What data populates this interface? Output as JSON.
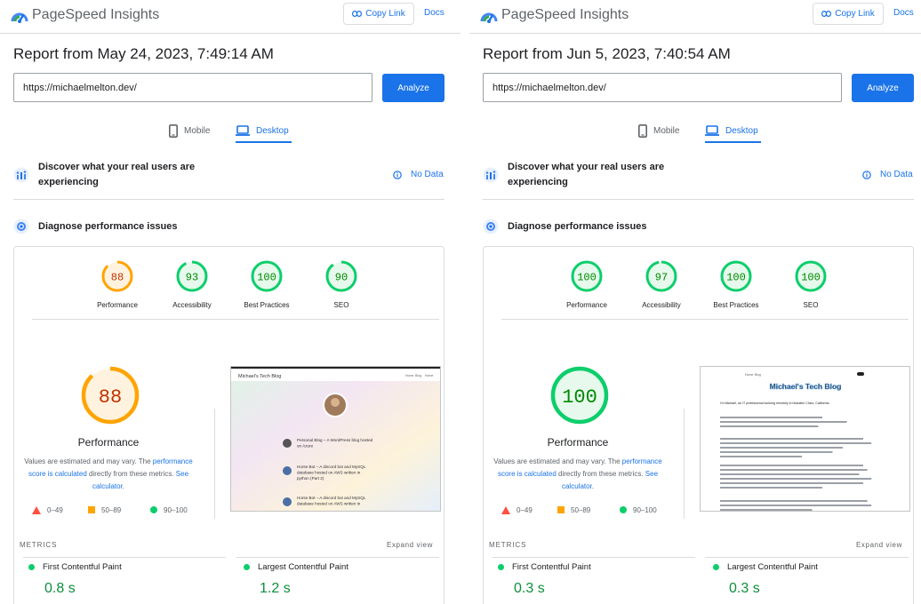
{
  "colors": {
    "pass": "#0cce6b",
    "pass_text": "#008800",
    "pass_fill": "#e6f9ec",
    "average": "#ffa400",
    "average_text": "#c33300",
    "average_fill": "#fff3e0",
    "fail": "#ff4e42",
    "accent": "#1a73e8"
  },
  "panels": [
    {
      "app_title": "PageSpeed Insights",
      "copy_link_label": "Copy Link",
      "docs_label": "Docs",
      "report_title": "Report from May 24, 2023, 7:49:14 AM",
      "url_value": "https://michaelmelton.dev/",
      "analyze_label": "Analyze",
      "tab_mobile": "Mobile",
      "tab_desktop": "Desktop",
      "discover_text": "Discover what your real users are experiencing",
      "no_data_label": "No Data",
      "diagnose_text": "Diagnose performance issues",
      "scores": [
        {
          "label": "Performance",
          "value": "88",
          "status": "average"
        },
        {
          "label": "Accessibility",
          "value": "93",
          "status": "pass"
        },
        {
          "label": "Best Practices",
          "value": "100",
          "status": "pass"
        },
        {
          "label": "SEO",
          "value": "90",
          "status": "pass"
        }
      ],
      "main_score": {
        "label": "Performance",
        "value": "88",
        "status": "average"
      },
      "estimate_text": {
        "prefix": "Values are estimated and may vary. The ",
        "link1": "performance score is calculated",
        "middle": " directly from these metrics. ",
        "link2": "See calculator."
      },
      "legend": [
        "0–49",
        "50–89",
        "90–100"
      ],
      "metrics_heading": "METRICS",
      "expand_label": "Expand view",
      "metrics": [
        {
          "name": "First Contentful Paint",
          "value": "0.8 s"
        },
        {
          "name": "Largest Contentful Paint",
          "value": "1.2 s"
        }
      ],
      "screenshot": {
        "site_title": "Michael's Tech Blog",
        "nav": [
          "Home",
          "Blog",
          "Home"
        ],
        "posts": [
          "Personal Blog – A WordPress blog hosted on Azure",
          "Horse Bot – A discord bot and MySQL database hosted on AWS written in python (Part 2)",
          "Horse Bot – A discord bot and MySQL database hosted on AWS written in"
        ]
      }
    },
    {
      "app_title": "PageSpeed Insights",
      "copy_link_label": "Copy Link",
      "docs_label": "Docs",
      "report_title": "Report from Jun 5, 2023, 7:40:54 AM",
      "url_value": "https://michaelmelton.dev/",
      "analyze_label": "Analyze",
      "tab_mobile": "Mobile",
      "tab_desktop": "Desktop",
      "discover_text": "Discover what your real users are experiencing",
      "no_data_label": "No Data",
      "diagnose_text": "Diagnose performance issues",
      "scores": [
        {
          "label": "Performance",
          "value": "100",
          "status": "pass"
        },
        {
          "label": "Accessibility",
          "value": "97",
          "status": "pass"
        },
        {
          "label": "Best Practices",
          "value": "100",
          "status": "pass"
        },
        {
          "label": "SEO",
          "value": "100",
          "status": "pass"
        }
      ],
      "main_score": {
        "label": "Performance",
        "value": "100",
        "status": "pass"
      },
      "estimate_text": {
        "prefix": "Values are estimated and may vary. The ",
        "link1": "performance score is calculated",
        "middle": " directly from these metrics. ",
        "link2": "See calculator."
      },
      "legend": [
        "0–49",
        "50–89",
        "90–100"
      ],
      "metrics_heading": "METRICS",
      "expand_label": "Expand view",
      "metrics": [
        {
          "name": "First Contentful Paint",
          "value": "0.3 s"
        },
        {
          "name": "Largest Contentful Paint",
          "value": "0.3 s"
        }
      ],
      "screenshot": {
        "site_title": "Michael's Tech Blog",
        "nav": [
          "Home",
          "Blog"
        ],
        "intro": "I'm Michael, an IT professional working remotely in beautiful Chico, California."
      }
    }
  ]
}
